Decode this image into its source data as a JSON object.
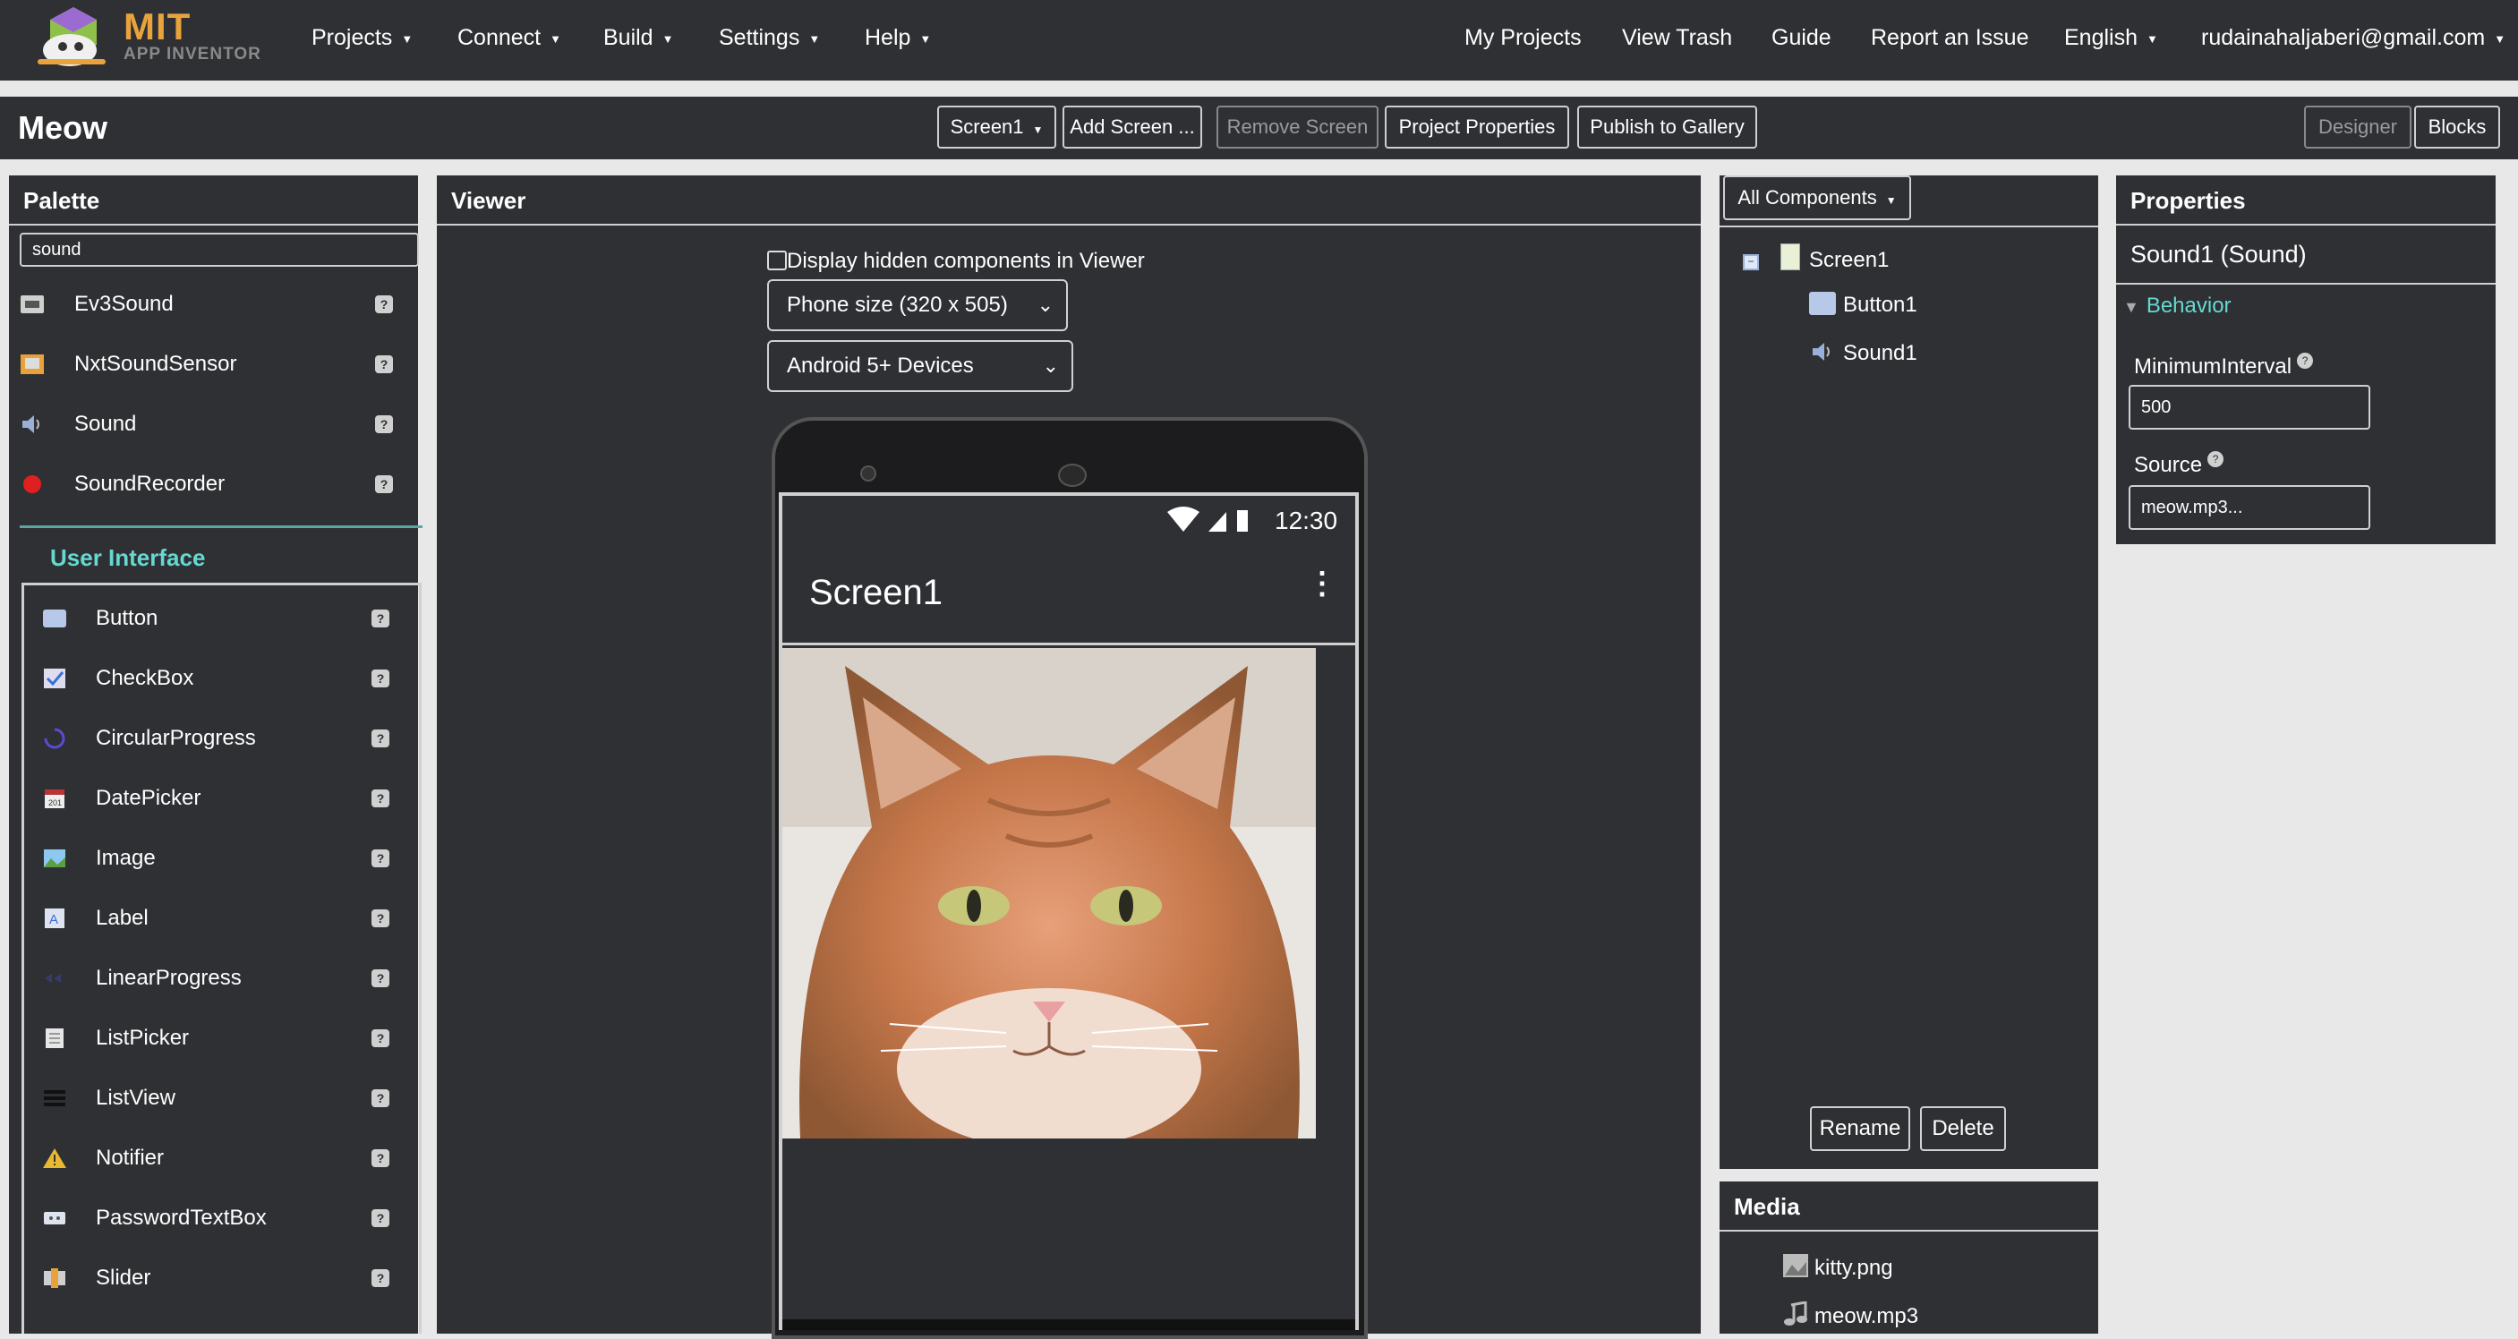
{
  "app": {
    "logo_mit": "MIT",
    "logo_sub": "APP INVENTOR"
  },
  "menu": {
    "projects": "Projects",
    "connect": "Connect",
    "build": "Build",
    "settings": "Settings",
    "help": "Help",
    "my_projects": "My Projects",
    "view_trash": "View Trash",
    "guide": "Guide",
    "report": "Report an Issue",
    "language": "English",
    "account": "rudainahaljaberi@gmail.com"
  },
  "toolbar": {
    "project_name": "Meow",
    "screen_select": "Screen1",
    "add_screen": "Add Screen ...",
    "remove_screen": "Remove Screen",
    "project_properties": "Project Properties",
    "publish": "Publish to Gallery",
    "designer": "Designer",
    "blocks": "Blocks"
  },
  "palette": {
    "title": "Palette",
    "search_value": "sound",
    "results": [
      {
        "label": "Ev3Sound",
        "icon": "ev3-sound-icon"
      },
      {
        "label": "NxtSoundSensor",
        "icon": "nxt-sound-sensor-icon"
      },
      {
        "label": "Sound",
        "icon": "speaker-icon"
      },
      {
        "label": "SoundRecorder",
        "icon": "record-dot-icon"
      }
    ],
    "section_title": "User Interface",
    "ui_items": [
      {
        "label": "Button",
        "icon": "button-icon"
      },
      {
        "label": "CheckBox",
        "icon": "checkbox-icon"
      },
      {
        "label": "CircularProgress",
        "icon": "circular-progress-icon"
      },
      {
        "label": "DatePicker",
        "icon": "calendar-icon"
      },
      {
        "label": "Image",
        "icon": "image-icon"
      },
      {
        "label": "Label",
        "icon": "label-icon"
      },
      {
        "label": "LinearProgress",
        "icon": "linear-progress-icon"
      },
      {
        "label": "ListPicker",
        "icon": "list-picker-icon"
      },
      {
        "label": "ListView",
        "icon": "list-view-icon"
      },
      {
        "label": "Notifier",
        "icon": "warning-icon"
      },
      {
        "label": "PasswordTextBox",
        "icon": "password-icon"
      },
      {
        "label": "Slider",
        "icon": "slider-icon"
      }
    ],
    "help_glyph": "?"
  },
  "viewer": {
    "title": "Viewer",
    "hidden_checkbox_label": "Display hidden components in Viewer",
    "phone_size": "Phone size (320 x 505)",
    "device": "Android 5+ Devices",
    "status_time": "12:30",
    "screen_title": "Screen1"
  },
  "components": {
    "filter": "All Components",
    "tree": [
      {
        "label": "Screen1",
        "icon": "screen-icon"
      },
      {
        "label": "Button1",
        "icon": "button-icon"
      },
      {
        "label": "Sound1",
        "icon": "speaker-icon"
      }
    ],
    "rename": "Rename",
    "delete": "Delete"
  },
  "media": {
    "title": "Media",
    "files": [
      {
        "label": "kitty.png",
        "icon": "image-file-icon"
      },
      {
        "label": "meow.mp3",
        "icon": "music-note-icon"
      }
    ]
  },
  "properties": {
    "title": "Properties",
    "component": "Sound1 (Sound)",
    "group": "Behavior",
    "min_interval_label": "MinimumInterval",
    "min_interval_value": "500",
    "source_label": "Source",
    "source_value": "meow.mp3..."
  },
  "colors": {
    "panel_bg": "#2e3033",
    "accent_teal": "#66d8d0",
    "logo_orange": "#e8a33d"
  }
}
